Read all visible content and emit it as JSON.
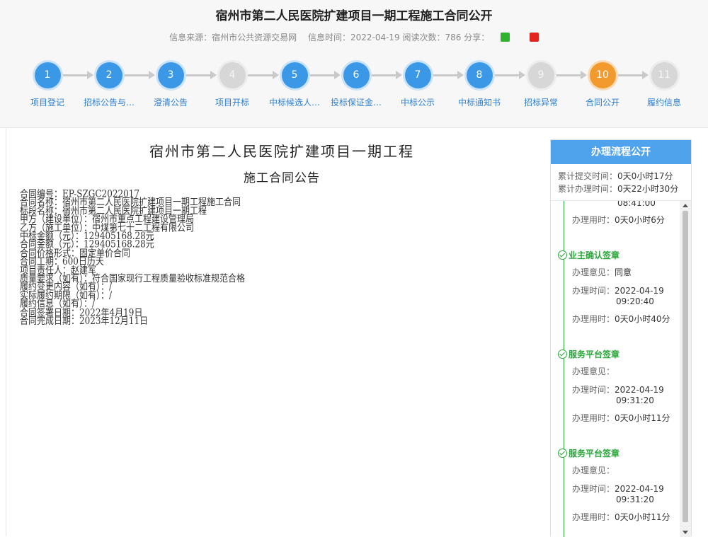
{
  "header": {
    "title": "宿州市第二人民医院扩建项目一期工程施工合同公开",
    "source_label": "信息来源：宿州市公共资源交易网",
    "time_label": "信息时间：2022-04-19 阅读次数：786 分享："
  },
  "steps": [
    {
      "num": "1",
      "label": "项目登记",
      "state": "done"
    },
    {
      "num": "2",
      "label": "招标公告与…",
      "state": "done"
    },
    {
      "num": "3",
      "label": "澄清公告",
      "state": "done"
    },
    {
      "num": "4",
      "label": "项目开标",
      "state": "todo"
    },
    {
      "num": "5",
      "label": "中标候选人…",
      "state": "done"
    },
    {
      "num": "6",
      "label": "投标保证金…",
      "state": "done"
    },
    {
      "num": "7",
      "label": "中标公示",
      "state": "done"
    },
    {
      "num": "8",
      "label": "中标通知书",
      "state": "done"
    },
    {
      "num": "9",
      "label": "招标异常",
      "state": "todo"
    },
    {
      "num": "10",
      "label": "合同公开",
      "state": "current"
    },
    {
      "num": "11",
      "label": "履约信息",
      "state": "todo"
    }
  ],
  "doc": {
    "title1": "宿州市第二人民医院扩建项目一期工程",
    "title2": "施工合同公告",
    "lines": [
      "合同编号：EP-SZGC2022017",
      "合同名称：宿州市第二人民医院扩建项目一期工程施工合同",
      "标段名称：宿州市第二人民医院扩建项目一期工程",
      "甲方（建设单位）：宿州市重点工程建设管理局",
      "乙方（施工单位）：中煤第七十二工程有限公司",
      "中标金额（元）：129405168.28元",
      "合同金额（元）：129405168.28元",
      "合同价格形式：固定单价合同",
      "合同工期：600日历天",
      "项目责任人：赵建军",
      "质量要求（如有）：符合国家现行工程质量验收标准规范合格",
      "履约变更内容（如有）：/",
      "实际履约期限（如有）：/",
      "履约信息（如有）：/",
      "合同签署日期：2022年4月19日",
      "合同完成日期：2023年12月11日"
    ]
  },
  "panel": {
    "title": "办理流程公开",
    "submit_label": "累计提交时间：",
    "submit_value": "0天0小时17分",
    "handle_label": "累计办理时间：",
    "handle_value": "0天22小时30分",
    "partial_time": "08:41:00",
    "first_duration_label": "办理用时：",
    "first_duration_value": "0天0小时6分",
    "entries": [
      {
        "title": "业主确认签章",
        "opinion_label": "办理意见：",
        "opinion": "同意",
        "time_label": "办理时间：",
        "date": "2022-04-19",
        "clock": "09:20:40",
        "dur_label": "办理用时：",
        "duration": "0天0小时40分"
      },
      {
        "title": "服务平台签章",
        "opinion_label": "办理意见：",
        "opinion": "",
        "time_label": "办理时间：",
        "date": "2022-04-19",
        "clock": "09:31:20",
        "dur_label": "办理用时：",
        "duration": "0天0小时11分"
      },
      {
        "title": "服务平台签章",
        "opinion_label": "办理意见：",
        "opinion": "",
        "time_label": "办理时间：",
        "date": "2022-04-19",
        "clock": "09:31:20",
        "dur_label": "办理用时：",
        "duration": "0天0小时11分"
      }
    ]
  },
  "colors": {
    "done": "#3b98e6",
    "current": "#f39a2e",
    "todo": "#d7d7d7",
    "accent_green": "#2aa83a",
    "panel_head": "#4ea3ec"
  }
}
